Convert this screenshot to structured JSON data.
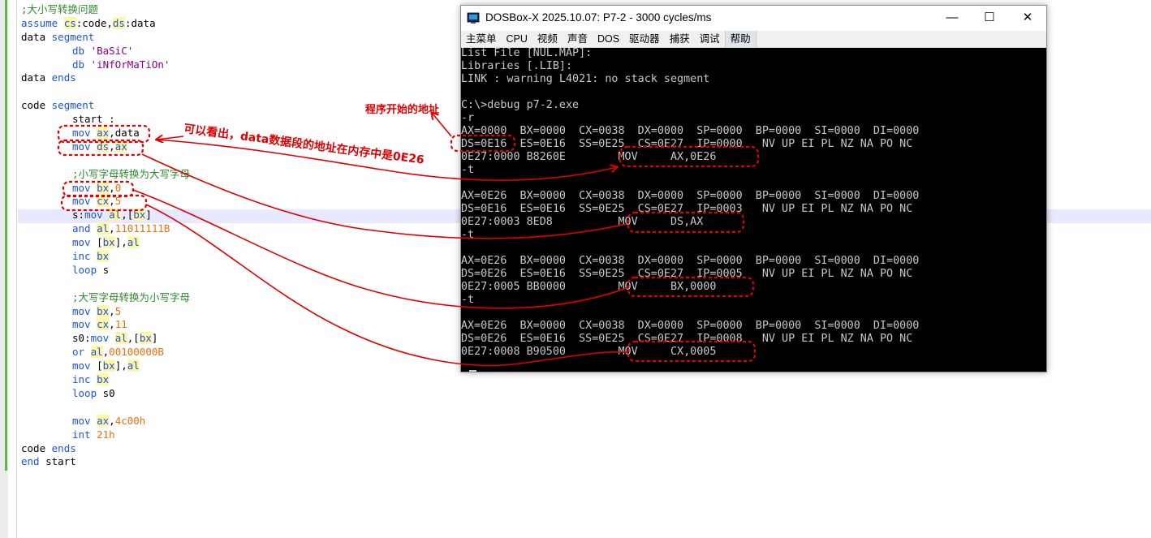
{
  "editor": {
    "lines": [
      [
        {
          "t": ";大小写转换问题",
          "c": "cmt"
        }
      ],
      [
        {
          "t": "assume ",
          "c": "kw"
        },
        {
          "t": "cs",
          "c": "reg hl"
        },
        {
          "t": ":code,",
          "c": "tk"
        },
        {
          "t": "ds",
          "c": "reg hl"
        },
        {
          "t": ":data",
          "c": "tk"
        }
      ],
      [
        {
          "t": "data ",
          "c": "tk"
        },
        {
          "t": "segment",
          "c": "kw"
        }
      ],
      [
        {
          "i": 1
        },
        {
          "t": "db ",
          "c": "kw"
        },
        {
          "t": "'BaSiC'",
          "c": "str"
        }
      ],
      [
        {
          "i": 1
        },
        {
          "t": "db ",
          "c": "kw"
        },
        {
          "t": "'iNfOrMaTiOn'",
          "c": "str"
        }
      ],
      [
        {
          "t": "data ",
          "c": "tk"
        },
        {
          "t": "ends",
          "c": "kw"
        }
      ],
      [],
      [
        {
          "t": "code ",
          "c": "tk"
        },
        {
          "t": "segment",
          "c": "kw"
        }
      ],
      [
        {
          "i": 1
        },
        {
          "t": "start :",
          "c": "tk"
        }
      ],
      [
        {
          "i": 1
        },
        {
          "t": "mov ",
          "c": "kw"
        },
        {
          "t": "ax",
          "c": "reg hl"
        },
        {
          "t": ",data",
          "c": "tk"
        }
      ],
      [
        {
          "i": 1
        },
        {
          "t": "mov ",
          "c": "kw"
        },
        {
          "t": "ds",
          "c": "reg hl"
        },
        {
          "t": ",",
          "c": "tk"
        },
        {
          "t": "ax",
          "c": "reg hl"
        }
      ],
      [],
      [
        {
          "i": 1
        },
        {
          "t": ";小写字母转换为大写字母",
          "c": "cmt"
        }
      ],
      [
        {
          "i": 1
        },
        {
          "t": "mov ",
          "c": "kw"
        },
        {
          "t": "bx",
          "c": "reg hl"
        },
        {
          "t": ",",
          "c": "tk"
        },
        {
          "t": "0",
          "c": "num"
        }
      ],
      [
        {
          "i": 1
        },
        {
          "t": "mov ",
          "c": "kw"
        },
        {
          "t": "cx",
          "c": "reg hl"
        },
        {
          "t": ",",
          "c": "tk"
        },
        {
          "t": "5",
          "c": "num"
        }
      ],
      [
        {
          "i": 1
        },
        {
          "t": "s:",
          "c": "tk"
        },
        {
          "t": "mov ",
          "c": "kw"
        },
        {
          "t": "al",
          "c": "reg hl"
        },
        {
          "t": ",[",
          "c": "tk"
        },
        {
          "t": "bx",
          "c": "reg hl"
        },
        {
          "t": "]",
          "c": "tk"
        }
      ],
      [
        {
          "i": 1
        },
        {
          "t": "and ",
          "c": "kw"
        },
        {
          "t": "al",
          "c": "reg hl"
        },
        {
          "t": ",",
          "c": "tk"
        },
        {
          "t": "11011111B",
          "c": "num"
        }
      ],
      [
        {
          "i": 1
        },
        {
          "t": "mov ",
          "c": "kw"
        },
        {
          "t": "[",
          "c": "tk"
        },
        {
          "t": "bx",
          "c": "reg hl"
        },
        {
          "t": "],",
          "c": "tk"
        },
        {
          "t": "al",
          "c": "reg hl"
        }
      ],
      [
        {
          "i": 1
        },
        {
          "t": "inc ",
          "c": "kw"
        },
        {
          "t": "bx",
          "c": "reg hl"
        }
      ],
      [
        {
          "i": 1
        },
        {
          "t": "loop ",
          "c": "kw"
        },
        {
          "t": "s",
          "c": "tk"
        }
      ],
      [],
      [
        {
          "i": 1
        },
        {
          "t": ";大写字母转换为小写字母",
          "c": "cmt"
        }
      ],
      [
        {
          "i": 1
        },
        {
          "t": "mov ",
          "c": "kw"
        },
        {
          "t": "bx",
          "c": "reg hl"
        },
        {
          "t": ",",
          "c": "tk"
        },
        {
          "t": "5",
          "c": "num"
        }
      ],
      [
        {
          "i": 1
        },
        {
          "t": "mov ",
          "c": "kw"
        },
        {
          "t": "cx",
          "c": "reg hl"
        },
        {
          "t": ",",
          "c": "tk"
        },
        {
          "t": "11",
          "c": "num"
        }
      ],
      [
        {
          "i": 1
        },
        {
          "t": "s0:",
          "c": "tk"
        },
        {
          "t": "mov ",
          "c": "kw"
        },
        {
          "t": "al",
          "c": "reg hl"
        },
        {
          "t": ",[",
          "c": "tk"
        },
        {
          "t": "bx",
          "c": "reg hl"
        },
        {
          "t": "]",
          "c": "tk"
        }
      ],
      [
        {
          "i": 1
        },
        {
          "t": "or ",
          "c": "kw"
        },
        {
          "t": "al",
          "c": "reg hl"
        },
        {
          "t": ",",
          "c": "tk"
        },
        {
          "t": "00100000B",
          "c": "num"
        }
      ],
      [
        {
          "i": 1
        },
        {
          "t": "mov ",
          "c": "kw"
        },
        {
          "t": "[",
          "c": "tk"
        },
        {
          "t": "bx",
          "c": "reg hl"
        },
        {
          "t": "],",
          "c": "tk"
        },
        {
          "t": "al",
          "c": "reg hl"
        }
      ],
      [
        {
          "i": 1
        },
        {
          "t": "inc ",
          "c": "kw"
        },
        {
          "t": "bx",
          "c": "reg hl"
        }
      ],
      [
        {
          "i": 1
        },
        {
          "t": "loop ",
          "c": "kw"
        },
        {
          "t": "s0",
          "c": "tk"
        }
      ],
      [],
      [
        {
          "i": 1
        },
        {
          "t": "mov ",
          "c": "kw"
        },
        {
          "t": "ax",
          "c": "reg hl"
        },
        {
          "t": ",",
          "c": "tk"
        },
        {
          "t": "4c00h",
          "c": "num"
        }
      ],
      [
        {
          "i": 1
        },
        {
          "t": "int ",
          "c": "kw"
        },
        {
          "t": "21h",
          "c": "num"
        }
      ],
      [
        {
          "t": "code ",
          "c": "tk"
        },
        {
          "t": "ends",
          "c": "kw"
        }
      ],
      [
        {
          "t": "end ",
          "c": "kw"
        },
        {
          "t": "start",
          "c": "tk"
        }
      ]
    ]
  },
  "dosbox": {
    "title": "DOSBox-X 2025.10.07: P7-2 - 3000 cycles/ms",
    "window_buttons": {
      "minimize": "—",
      "maximize": "☐",
      "close": "✕"
    },
    "menu": [
      "主菜单",
      "CPU",
      "视频",
      "声音",
      "DOS",
      "驱动器",
      "捕获",
      "调试",
      "帮助"
    ],
    "terminal_lines": [
      "List File [NUL.MAP]:",
      "Libraries [.LIB]:",
      "LINK : warning L4021: no stack segment",
      "",
      "C:\\>debug p7-2.exe",
      "-r",
      "AX=0000  BX=0000  CX=0038  DX=0000  SP=0000  BP=0000  SI=0000  DI=0000",
      "DS=0E16  ES=0E16  SS=0E25  CS=0E27  IP=0000   NV UP EI PL NZ NA PO NC",
      "0E27:0000 B8260E        MOV     AX,0E26",
      "-t",
      "",
      "AX=0E26  BX=0000  CX=0038  DX=0000  SP=0000  BP=0000  SI=0000  DI=0000",
      "DS=0E16  ES=0E16  SS=0E25  CS=0E27  IP=0003   NV UP EI PL NZ NA PO NC",
      "0E27:0003 8ED8          MOV     DS,AX",
      "-t",
      "",
      "AX=0E26  BX=0000  CX=0038  DX=0000  SP=0000  BP=0000  SI=0000  DI=0000",
      "DS=0E26  ES=0E16  SS=0E25  CS=0E27  IP=0005   NV UP EI PL NZ NA PO NC",
      "0E27:0005 BB0000        MOV     BX,0000",
      "-t",
      "",
      "AX=0E26  BX=0000  CX=0038  DX=0000  SP=0000  BP=0000  SI=0000  DI=0000",
      "DS=0E26  ES=0E16  SS=0E25  CS=0E27  IP=0008   NV UP EI PL NZ NA PO NC",
      "0E27:0008 B90500        MOV     CX,0005"
    ]
  },
  "annotations": {
    "program_start": "程序开始的地址",
    "data_segment": "可以看出，data数据段的地址在内存中是0E26"
  },
  "colors": {
    "annotation": "#e00000",
    "keyword": "#1c52e0",
    "comment": "#2d8a2d",
    "number": "#f0700a",
    "string": "#8b008b",
    "fold_bar": "#5fb84a",
    "terminal_text": "#c8c8c8"
  }
}
